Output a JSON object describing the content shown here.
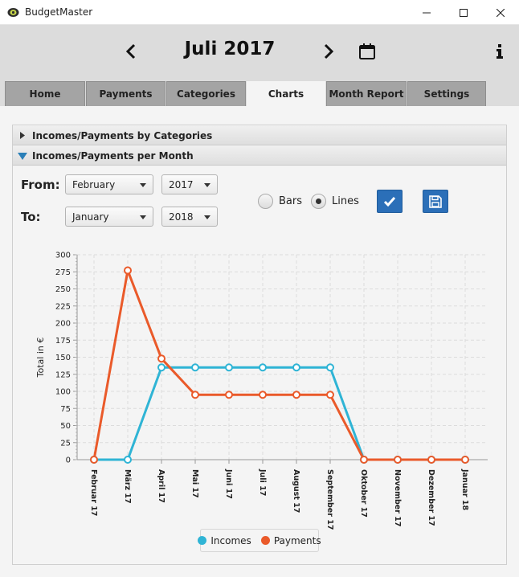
{
  "window": {
    "title": "BudgetMaster"
  },
  "header": {
    "month_title": "Juli 2017"
  },
  "tabs": [
    {
      "label": "Home"
    },
    {
      "label": "Payments"
    },
    {
      "label": "Categories"
    },
    {
      "label": "Charts"
    },
    {
      "label": "Month Report"
    },
    {
      "label": "Settings"
    }
  ],
  "active_tab": "Charts",
  "accordion": {
    "section1": "Incomes/Payments by Categories",
    "section2": "Incomes/Payments per Month"
  },
  "form": {
    "from_label": "From:",
    "to_label": "To:",
    "from_month": "February",
    "from_year": "2017",
    "to_month": "January",
    "to_year": "2018",
    "radio_bars": "Bars",
    "radio_lines": "Lines",
    "selected": "Lines"
  },
  "colors": {
    "incomes": "#2fb4d5",
    "payments": "#ea5a2a",
    "accent_button": "#2b6fb8"
  },
  "icons": {
    "prev": "chevron-left-icon",
    "next": "chevron-right-icon",
    "calendar": "calendar-icon",
    "info": "info-icon",
    "apply": "checkmark-icon",
    "save": "save-icon"
  },
  "chart_data": {
    "type": "line",
    "categories": [
      "Februar 17",
      "März 17",
      "April 17",
      "Mai 17",
      "Juni 17",
      "Juli 17",
      "August 17",
      "September 17",
      "Oktober 17",
      "November 17",
      "Dezember 17",
      "Januar 18"
    ],
    "series": [
      {
        "name": "Incomes",
        "values": [
          0,
          0,
          135,
          135,
          135,
          135,
          135,
          135,
          0,
          0,
          0,
          0
        ]
      },
      {
        "name": "Payments",
        "values": [
          0,
          277,
          148,
          95,
          95,
          95,
          95,
          95,
          0,
          0,
          0,
          0
        ]
      }
    ],
    "title": "",
    "xlabel": "",
    "ylabel": "Total in €",
    "ylim": [
      0,
      300
    ],
    "ytick_step": 25,
    "yticks": [
      "0",
      "25",
      "50",
      "75",
      "100",
      "125",
      "150",
      "175",
      "200",
      "225",
      "250",
      "275",
      "300"
    ],
    "grid": true,
    "legend": "bottom-center"
  }
}
